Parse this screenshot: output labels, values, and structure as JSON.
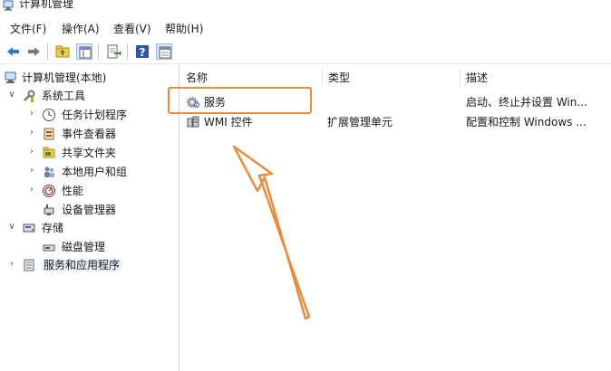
{
  "window": {
    "title": "计算机管理",
    "app_icon": "computer-management-icon"
  },
  "menu": {
    "items": [
      {
        "label": "文件(F)"
      },
      {
        "label": "操作(A)"
      },
      {
        "label": "查看(V)"
      },
      {
        "label": "帮助(H)"
      }
    ]
  },
  "toolbar": {
    "buttons": [
      {
        "icon": "back-arrow-icon"
      },
      {
        "icon": "forward-arrow-icon"
      },
      {
        "icon": "up-folder-icon"
      },
      {
        "icon": "show-hide-tree-icon"
      },
      {
        "icon": "export-list-icon"
      },
      {
        "icon": "help-icon"
      },
      {
        "icon": "properties-icon"
      }
    ]
  },
  "tree": {
    "items": [
      {
        "label": "计算机管理(本地)",
        "icon": "computer-management-icon"
      },
      {
        "label": "系统工具",
        "icon": "tools-icon",
        "expanded": true
      },
      {
        "label": "任务计划程序",
        "icon": "clock-icon"
      },
      {
        "label": "事件查看器",
        "icon": "event-viewer-icon"
      },
      {
        "label": "共享文件夹",
        "icon": "shared-folder-icon"
      },
      {
        "label": "本地用户和组",
        "icon": "users-icon"
      },
      {
        "label": "性能",
        "icon": "performance-icon"
      },
      {
        "label": "设备管理器",
        "icon": "device-manager-icon"
      },
      {
        "label": "存储",
        "icon": "storage-icon",
        "expanded": true
      },
      {
        "label": "磁盘管理",
        "icon": "disk-icon"
      },
      {
        "label": "服务和应用程序",
        "icon": "services-apps-icon",
        "selected": true
      }
    ]
  },
  "list": {
    "columns": [
      {
        "label": "名称"
      },
      {
        "label": "类型"
      },
      {
        "label": "描述"
      }
    ],
    "rows": [
      {
        "name": "服务",
        "type": "",
        "description": "启动、终止并设置 Win...",
        "icon": "gear-icon"
      },
      {
        "name": "WMI 控件",
        "type": "扩展管理单元",
        "description": "配置和控制 Windows ...",
        "icon": "wmi-control-icon"
      }
    ]
  },
  "colors": {
    "annotation": "#ec8b3c",
    "selection": "#e5f1fb"
  }
}
